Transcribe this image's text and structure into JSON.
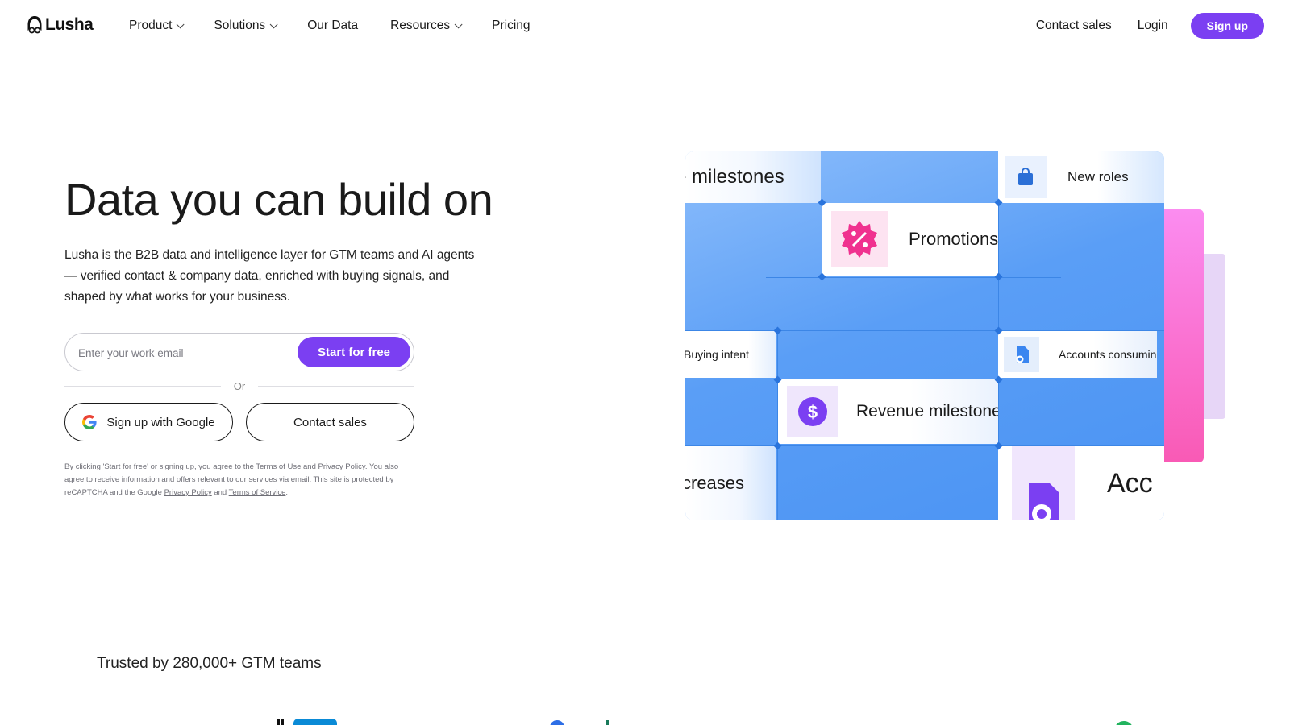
{
  "nav": {
    "logo": "Lusha",
    "links": [
      {
        "label": "Product",
        "dropdown": true
      },
      {
        "label": "Solutions",
        "dropdown": true
      },
      {
        "label": "Our Data",
        "dropdown": false
      },
      {
        "label": "Resources",
        "dropdown": true
      },
      {
        "label": "Pricing",
        "dropdown": false
      }
    ],
    "contact_sales": "Contact sales",
    "login": "Login",
    "signup": "Sign up"
  },
  "hero": {
    "title": "Data you can build on",
    "description": "Lusha is the B2B data and intelligence layer for GTM teams and AI agents — verified contact & company data, enriched with buying signals, and shaped by what works for your business.",
    "email_placeholder": "Enter your work email",
    "start_button": "Start for free",
    "or": "Or",
    "google_button": "Sign up with Google",
    "contact_button": "Contact sales",
    "legal": {
      "p1": "By clicking 'Start for free' or signing up, you agree to the ",
      "terms_of_use": "Terms of Use",
      "and1": " and ",
      "privacy1": "Privacy Policy",
      "p2": ". You also agree to receive information and offers relevant to our services via email. This site is protected by reCAPTCHA and the Google ",
      "privacy2": "Privacy Policy",
      "and2": " and ",
      "terms_of_service": "Terms of Service",
      "p3": "."
    }
  },
  "visual": {
    "tiles": {
      "milestones": "e milestones",
      "new_roles": "New roles",
      "promotions": "Promotions",
      "buying_intent": "Buying intent",
      "accounts_consuming": "Accounts consumin",
      "revenue_milestones": "Revenue milestones",
      "increases": "creases",
      "accounts_short": "Acc"
    },
    "colors": {
      "grid_blue": "#5a9ef6",
      "accent_purple": "#7b3ff2",
      "pink": "#f95ab5"
    }
  },
  "trusted": {
    "text": "Trusted by 280,000+ GTM teams"
  }
}
